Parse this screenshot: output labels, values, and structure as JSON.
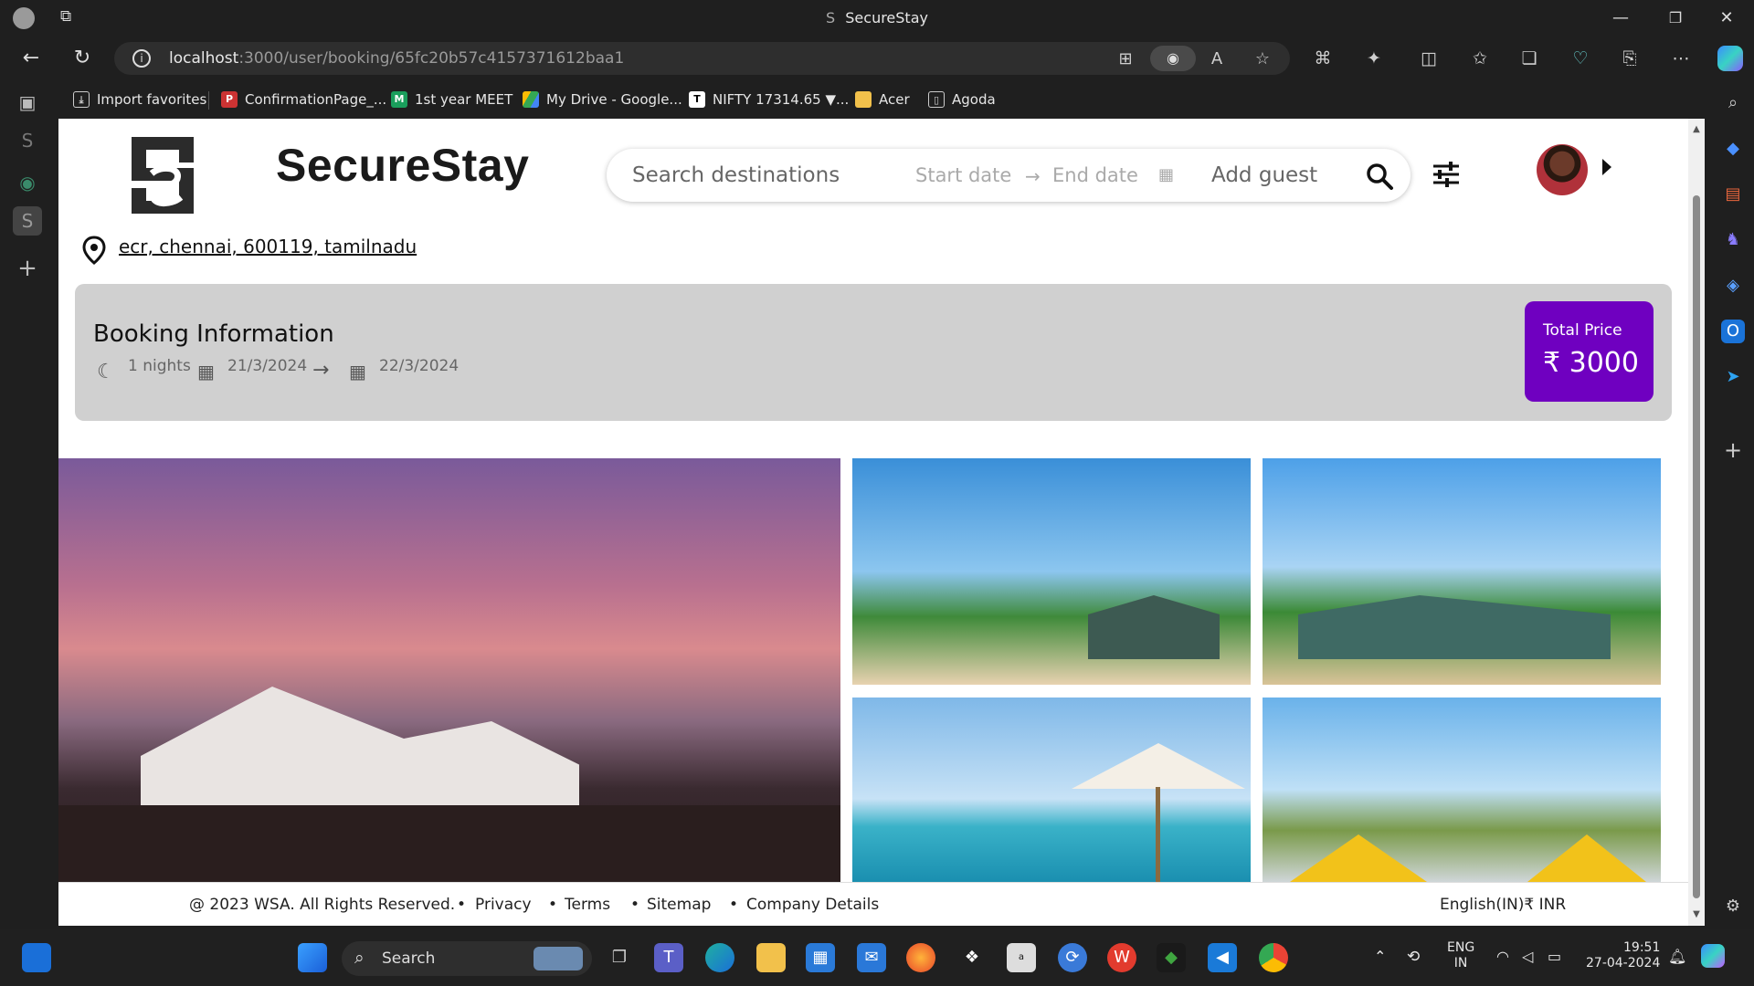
{
  "window": {
    "title": "SecureStay",
    "minimize": "—",
    "maximize": "❐",
    "close": "✕"
  },
  "browser": {
    "url_host": "localhost",
    "url_path": ":3000/user/booking/65fc20b57c4157371612baa1",
    "favorites": [
      {
        "label": "Import favorites",
        "icon": "import-icon"
      },
      {
        "label": "ConfirmationPage_...",
        "icon": "pdf-icon"
      },
      {
        "label": "1st year MEET",
        "icon": "meet-icon"
      },
      {
        "label": "My Drive - Google...",
        "icon": "drive-icon"
      },
      {
        "label": "NIFTY 17314.65 ▼...",
        "icon": "tradingview-icon"
      },
      {
        "label": "Acer",
        "icon": "folder-icon"
      },
      {
        "label": "Agoda",
        "icon": "page-icon"
      }
    ]
  },
  "app": {
    "brand": "SecureStay",
    "search": {
      "destination_placeholder": "Search destinations",
      "start_placeholder": "Start date",
      "end_placeholder": "End date",
      "guest_placeholder": "Add guest"
    },
    "address": "ecr, chennai, 600119, tamilnadu",
    "booking": {
      "heading": "Booking Information",
      "nights": "1 nights",
      "check_in": "21/3/2024",
      "check_out": "22/3/2024",
      "total_label": "Total Price",
      "total_value": "₹ 3000"
    },
    "footer": {
      "copyright": "@ 2023 WSA. All Rights Reserved.",
      "links": [
        "Privacy",
        "Terms",
        "Sitemap",
        "Company Details"
      ],
      "locale": "English(IN)₹ INR"
    }
  },
  "taskbar": {
    "search_label": "Search",
    "lang_top": "ENG",
    "lang_bottom": "IN",
    "time": "19:51",
    "date": "27-04-2024"
  }
}
